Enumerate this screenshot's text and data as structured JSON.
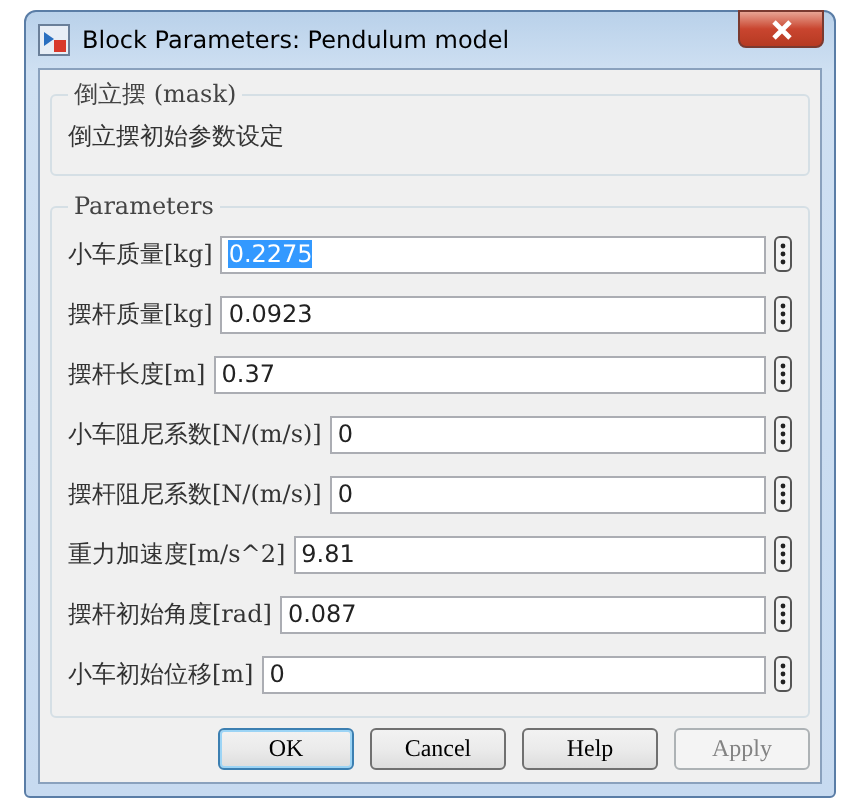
{
  "window": {
    "title": "Block Parameters: Pendulum model"
  },
  "mask_group": {
    "title": "倒立摆 (mask)",
    "description": "倒立摆初始参数设定"
  },
  "parameters_group": {
    "title": "Parameters",
    "fields": [
      {
        "label": "小车质量[kg]",
        "value": "0.2275",
        "selected": true
      },
      {
        "label": "摆杆质量[kg]",
        "value": "0.0923",
        "selected": false
      },
      {
        "label": "摆杆长度[m]",
        "value": "0.37",
        "selected": false
      },
      {
        "label": "小车阻尼系数[N/(m/s)]",
        "value": "0",
        "selected": false
      },
      {
        "label": "摆杆阻尼系数[N/(m/s)]",
        "value": "0",
        "selected": false
      },
      {
        "label": "重力加速度[m/s^2]",
        "value": "9.81",
        "selected": false
      },
      {
        "label": "摆杆初始角度[rad]",
        "value": "0.087",
        "selected": false
      },
      {
        "label": "小车初始位移[m]",
        "value": "0",
        "selected": false
      }
    ]
  },
  "buttons": [
    {
      "label": "OK",
      "disabled": false,
      "default": true
    },
    {
      "label": "Cancel",
      "disabled": false,
      "default": false
    },
    {
      "label": "Help",
      "disabled": false,
      "default": false
    },
    {
      "label": "Apply",
      "disabled": true,
      "default": false
    }
  ]
}
